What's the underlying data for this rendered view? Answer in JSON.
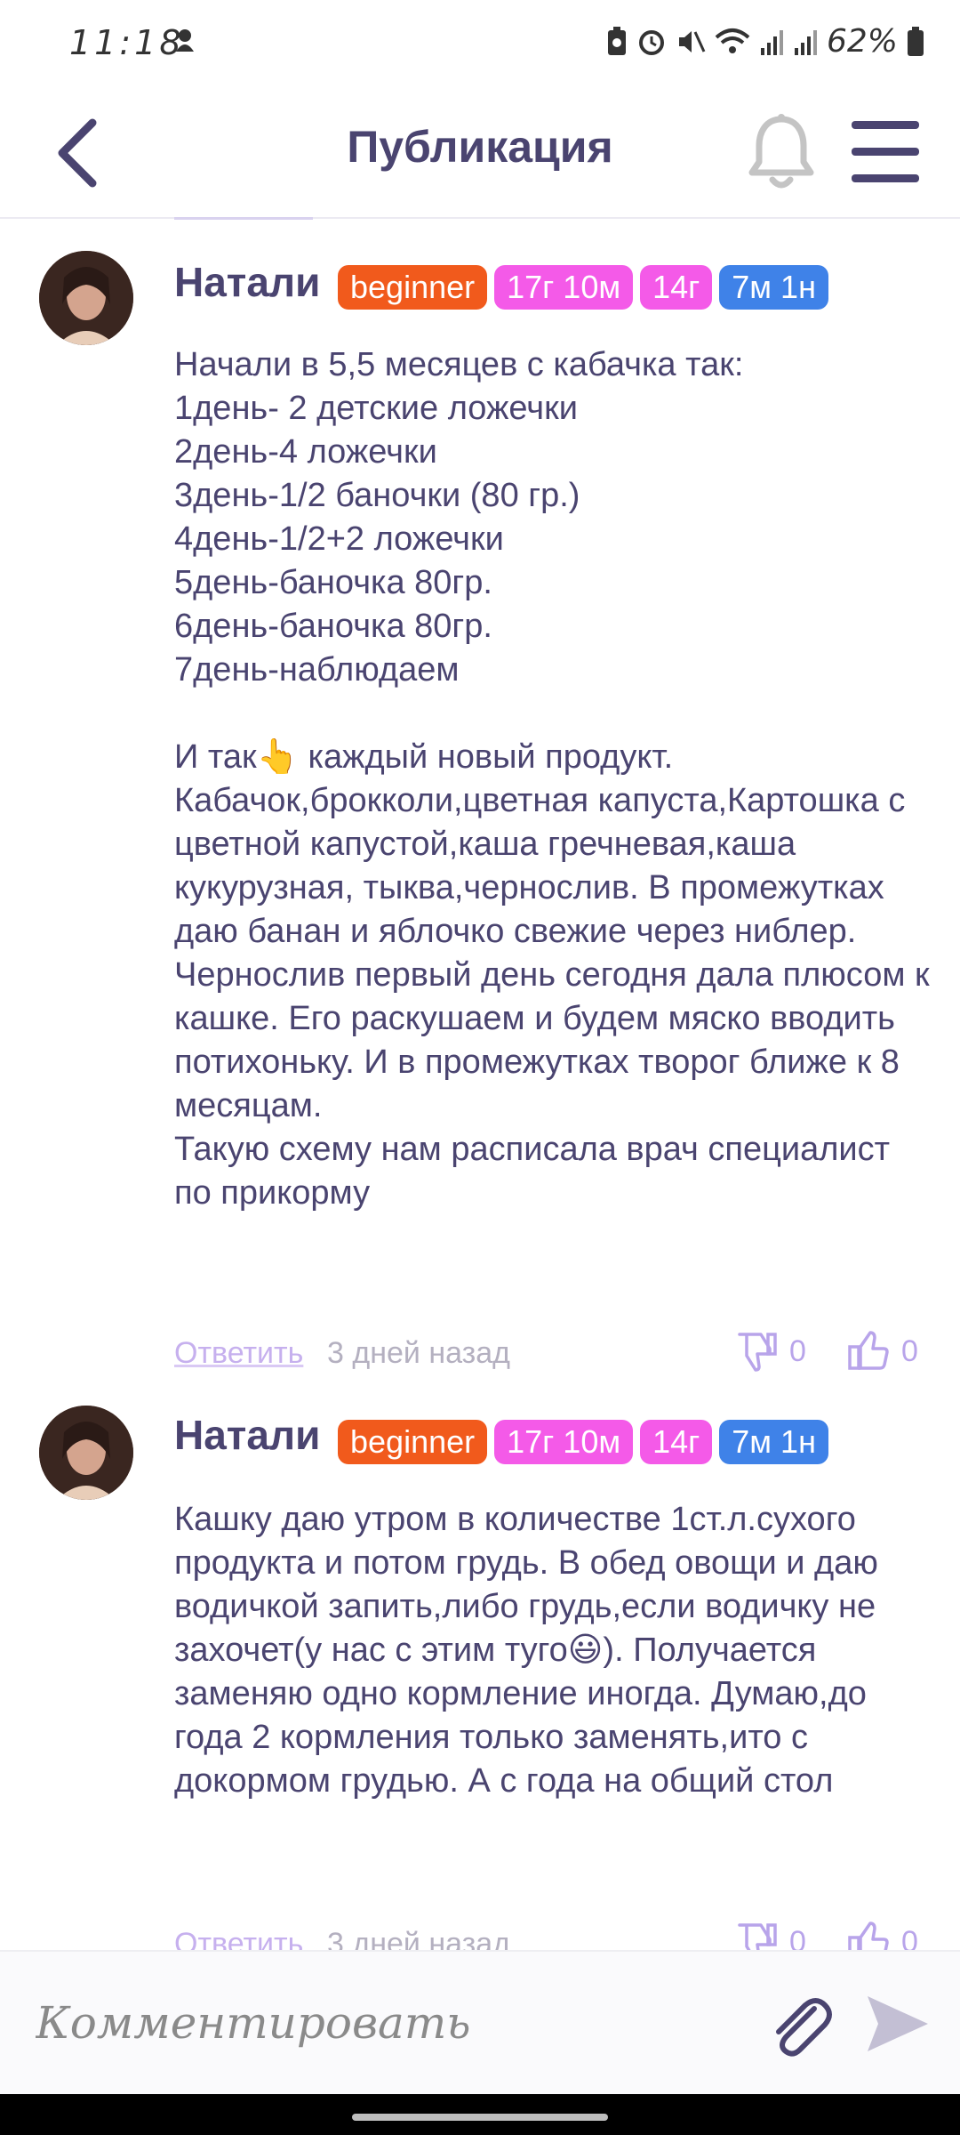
{
  "status": {
    "time": "11:18",
    "battery": "62%"
  },
  "header": {
    "title": "Публикация"
  },
  "comments": [
    {
      "author": "Натали",
      "badges": [
        "beginner",
        "17г 10м",
        "14г",
        "7м 1н"
      ],
      "text": "Начали в 5,5 месяцев с кабачка так:\n1день- 2 детские ложечки\n2день-4 ложечки\n3день-1/2 баночки (80 гр.)\n4день-1/2+2 ложечки\n5день-баночка 80гр.\n6день-баночка 80гр.\n7день-наблюдаем\n\nИ так👆 каждый новый продукт. Кабачок,брокколи,цветная капуста,Картошка с цветной капустой,каша гречневая,каша кукурузная, тыква,чернослив. В промежутках даю банан и яблочко свежие через ниблер. Чернослив первый день сегодня дала плюсом к кашке. Его раскушаем и будем мяско вводить потихоньку. И в промежутках творог ближе к 8 месяцам.\nТакую схему нам расписала врач специалист по прикорму",
      "reply": "Ответить",
      "time_ago": "3 дней назад",
      "dislikes": "0",
      "likes": "0"
    },
    {
      "author": "Натали",
      "badges": [
        "beginner",
        "17г 10м",
        "14г",
        "7м 1н"
      ],
      "text": "Кашку даю утром в количестве 1ст.л.сухого продукта и потом грудь. В обед овощи и даю водичкой запить,либо грудь,если водичку не захочет(у нас с этим туго😃). Получается заменяю одно кормление иногда. Думаю,до года 2 кормления только заменять,ито с докормом грудью. А с года на общий стол",
      "reply": "Ответить",
      "time_ago": "3 дней назад",
      "dislikes": "0",
      "likes": "0"
    }
  ],
  "input": {
    "placeholder": "Комментировать"
  }
}
